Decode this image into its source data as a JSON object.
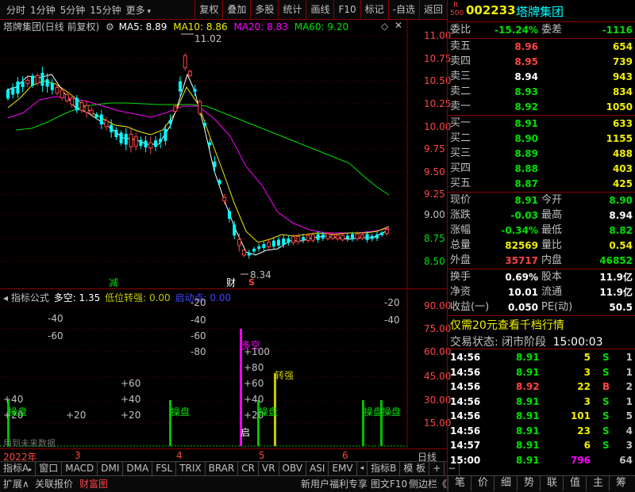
{
  "toolbar": {
    "periods": [
      "分时",
      "1分钟",
      "5分钟",
      "15分钟",
      "更多"
    ],
    "buttons": [
      "复权",
      "叠加",
      "多股",
      "统计",
      "画线",
      "F10",
      "标记",
      "-自选",
      "返回"
    ]
  },
  "main_chart": {
    "title": "塔牌集团(日线 前复权)",
    "ma5": "MA5: 8.89",
    "ma10": "MA10: 8.86",
    "ma20": "MA20: 8.83",
    "ma60": "MA60: 9.20",
    "high_label": "11.02",
    "low_label": "8.34",
    "price_ticks": [
      "11.00",
      "10.75",
      "10.50",
      "10.25",
      "10.00",
      "9.75",
      "9.50",
      "9.25",
      "9.00",
      "8.75",
      "8.50"
    ],
    "markers": {
      "jian": "减",
      "cai": "财",
      "s": "S"
    },
    "colors": {
      "ma5": "#ffffff",
      "ma10": "#f0f000",
      "ma20": "#ff00ff",
      "ma60": "#00e000",
      "up": "#ff4444",
      "down": "#00ffff"
    }
  },
  "indicator": {
    "name": "指标公式",
    "duokong": "多空: 1.35",
    "dwzq": "低位转强: 0.00",
    "qdd": "启动点: 0.00",
    "axis_ticks": [
      "90.00",
      "75.00",
      "60.00",
      "45.00",
      "30.00",
      "15.00"
    ],
    "labels": {
      "minus40a": "-40",
      "minus60a": "-60",
      "plus40": "+40",
      "plus20a": "+20",
      "plus20b": "+20",
      "plus60": "+60",
      "plus40b": "+40",
      "plus20c": "+20",
      "minus20a": "-20",
      "minus40b": "-40",
      "minus60b": "-60",
      "minus80": "-80",
      "plus100": "+100",
      "plus80": "+80",
      "plus60b": "+60",
      "plus40c": "+40",
      "plus20d": "+20",
      "minus20b": "-20",
      "minus40c": "-40",
      "caopan1": "操盘",
      "caopan2": "操盘",
      "caopan3": "操盘",
      "caopan4": "操盘",
      "caopan5": "操盘",
      "duokong_txt": "多空",
      "zhuanqiang": "转强",
      "qi": "启",
      "future": "用到未来数据"
    }
  },
  "date_axis": {
    "year": "2022年",
    "m3": "3",
    "m4": "4",
    "m5": "5",
    "m6": "6",
    "period": "日线"
  },
  "tabs": [
    "指标A",
    "窗口",
    "MACD",
    "DMI",
    "DMA",
    "FSL",
    "TRIX",
    "BRAR",
    "CR",
    "VR",
    "OBV",
    "ASI",
    "EMV",
    "指标B",
    "模 板",
    "+",
    "−"
  ],
  "bottom": {
    "expand": "扩展∧",
    "relation": "关联报价",
    "caifutu": "财富图",
    "promo": "新用户福利专享",
    "f10": "图文F10",
    "sidebar": "侧边栏《"
  },
  "nav": [
    "笔",
    "价",
    "细",
    "势",
    "联",
    "值",
    "主",
    "筹"
  ],
  "quote": {
    "r_label": "R",
    "r_num": "500",
    "code": "002233",
    "name": "塔牌集团",
    "weibi_l": "委比",
    "weibi": "-15.24%",
    "weicha_l": "委差",
    "weicha": "-1116",
    "asks": [
      {
        "l": "卖五",
        "p": "8.96",
        "v": "654"
      },
      {
        "l": "卖四",
        "p": "8.95",
        "v": "739"
      },
      {
        "l": "卖三",
        "p": "8.94",
        "v": "943"
      },
      {
        "l": "卖二",
        "p": "8.93",
        "v": "834"
      },
      {
        "l": "卖一",
        "p": "8.92",
        "v": "1050"
      }
    ],
    "bids": [
      {
        "l": "买一",
        "p": "8.91",
        "v": "633"
      },
      {
        "l": "买二",
        "p": "8.90",
        "v": "1155"
      },
      {
        "l": "买三",
        "p": "8.89",
        "v": "488"
      },
      {
        "l": "买四",
        "p": "8.88",
        "v": "403"
      },
      {
        "l": "买五",
        "p": "8.87",
        "v": "425"
      }
    ],
    "stats": [
      {
        "l1": "现价",
        "v1": "8.91",
        "l2": "今开",
        "v2": "8.90"
      },
      {
        "l1": "涨跌",
        "v1": "-0.03",
        "l2": "最高",
        "v2": "8.94"
      },
      {
        "l1": "涨幅",
        "v1": "-0.34%",
        "l2": "最低",
        "v2": "8.82"
      },
      {
        "l1": "总量",
        "v1": "82569",
        "l2": "量比",
        "v2": "0.54"
      },
      {
        "l1": "外盘",
        "v1": "35717",
        "l2": "内盘",
        "v2": "46852"
      }
    ],
    "stats2": [
      {
        "l1": "换手",
        "v1": "0.69%",
        "l2": "股本",
        "v2": "11.9亿"
      },
      {
        "l1": "净资",
        "v1": "10.01",
        "l2": "流通",
        "v2": "11.9亿"
      },
      {
        "l1": "收益(一)",
        "v1": "0.050",
        "l2": "PE(动)",
        "v2": "50.5"
      }
    ],
    "promo": "仅需20元查看千档行情",
    "status_l": "交易状态:",
    "status": "闭市阶段",
    "status_time": "15:00:03",
    "ticks": [
      {
        "t": "14:56",
        "p": "8.91",
        "v": "5",
        "d": "S",
        "n": "1"
      },
      {
        "t": "14:56",
        "p": "8.91",
        "v": "3",
        "d": "S",
        "n": "1"
      },
      {
        "t": "14:56",
        "p": "8.92",
        "v": "22",
        "d": "B",
        "n": "2"
      },
      {
        "t": "14:56",
        "p": "8.91",
        "v": "3",
        "d": "S",
        "n": "1"
      },
      {
        "t": "14:56",
        "p": "8.91",
        "v": "101",
        "d": "S",
        "n": "5"
      },
      {
        "t": "14:56",
        "p": "8.91",
        "v": "23",
        "d": "S",
        "n": "4"
      },
      {
        "t": "14:57",
        "p": "8.91",
        "v": "6",
        "d": "S",
        "n": "3"
      },
      {
        "t": "15:00",
        "p": "8.91",
        "v": "796",
        "d": "",
        "n": "64"
      }
    ]
  }
}
